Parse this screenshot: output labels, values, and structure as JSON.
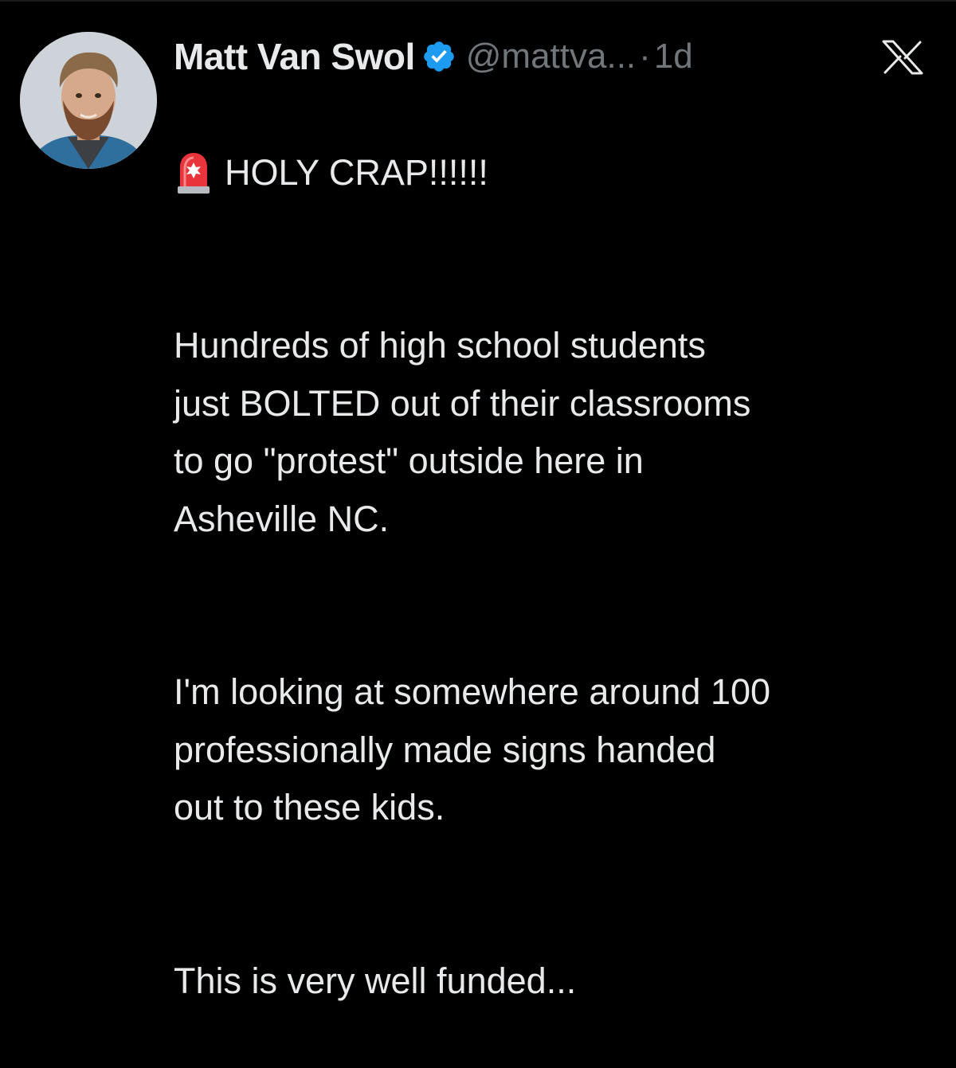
{
  "author": {
    "name": "Matt Van Swol",
    "handle": "@mattva...",
    "separator": "·",
    "timestamp": "1d",
    "verified_icon": "verified-badge-icon",
    "verified_color": "#1d9bf0"
  },
  "platform": {
    "logo_icon": "x-logo-icon"
  },
  "tweet": {
    "emoji_icon": "police-siren-icon",
    "headline": "HOLY CRAP!!!!!!",
    "paragraph_1": "Hundreds of high school students\njust BOLTED out of their classrooms\nto go \"protest\" outside here in\nAsheville NC.",
    "paragraph_2": "I'm looking at somewhere around 100\nprofessionally made signs handed\nout to these kids.",
    "paragraph_3": "This is very well funded..."
  },
  "colors": {
    "background": "#000000",
    "text": "#e7e9ea",
    "muted": "#71767b"
  }
}
